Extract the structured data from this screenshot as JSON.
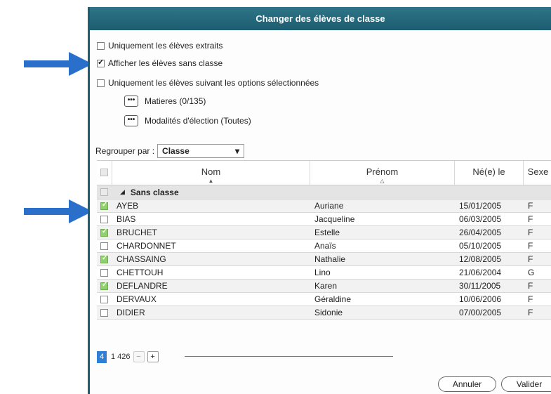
{
  "dialog": {
    "title": "Changer des élèves de classe"
  },
  "options": [
    {
      "label": "Uniquement les élèves extraits",
      "checked": false
    },
    {
      "label": "Afficher les élèves sans classe",
      "checked": true
    },
    {
      "label": "Uniquement les élèves suivant les options sélectionnées",
      "checked": false
    }
  ],
  "sub_options": [
    {
      "label": "Matieres (0/135)"
    },
    {
      "label": "Modalités d'élection (Toutes)"
    }
  ],
  "group_by": {
    "label": "Regrouper par :",
    "value": "Classe"
  },
  "table": {
    "columns": [
      "Nom",
      "Prénom",
      "Né(e) le",
      "Sexe"
    ],
    "group_label": "Sans classe",
    "rows": [
      {
        "checked": true,
        "nom": "AYEB",
        "prenom": "Auriane",
        "ne": "15/01/2005",
        "sexe": "F"
      },
      {
        "checked": false,
        "nom": "BIAS",
        "prenom": "Jacqueline",
        "ne": "06/03/2005",
        "sexe": "F"
      },
      {
        "checked": true,
        "nom": "BRUCHET",
        "prenom": "Estelle",
        "ne": "26/04/2005",
        "sexe": "F"
      },
      {
        "checked": false,
        "nom": "CHARDONNET",
        "prenom": "Anaïs",
        "ne": "05/10/2005",
        "sexe": "F"
      },
      {
        "checked": true,
        "nom": "CHASSAING",
        "prenom": "Nathalie",
        "ne": "12/08/2005",
        "sexe": "F"
      },
      {
        "checked": false,
        "nom": "CHETTOUH",
        "prenom": "Lino",
        "ne": "21/06/2004",
        "sexe": "G"
      },
      {
        "checked": true,
        "nom": "DEFLANDRE",
        "prenom": "Karen",
        "ne": "30/11/2005",
        "sexe": "F"
      },
      {
        "checked": false,
        "nom": "DERVAUX",
        "prenom": "Géraldine",
        "ne": "10/06/2006",
        "sexe": "F"
      },
      {
        "checked": false,
        "nom": "DIDIER",
        "prenom": "Sidonie",
        "ne": "07/00/2005",
        "sexe": "F"
      }
    ]
  },
  "footer": {
    "page": "4",
    "count": "1 426"
  },
  "buttons": {
    "cancel": "Annuler",
    "validate": "Valider"
  },
  "colors": {
    "titlebar": "#1d5d70",
    "arrow": "#2a6fc9",
    "check_green": "#8fd16a",
    "page_blue": "#2e7fd6"
  }
}
